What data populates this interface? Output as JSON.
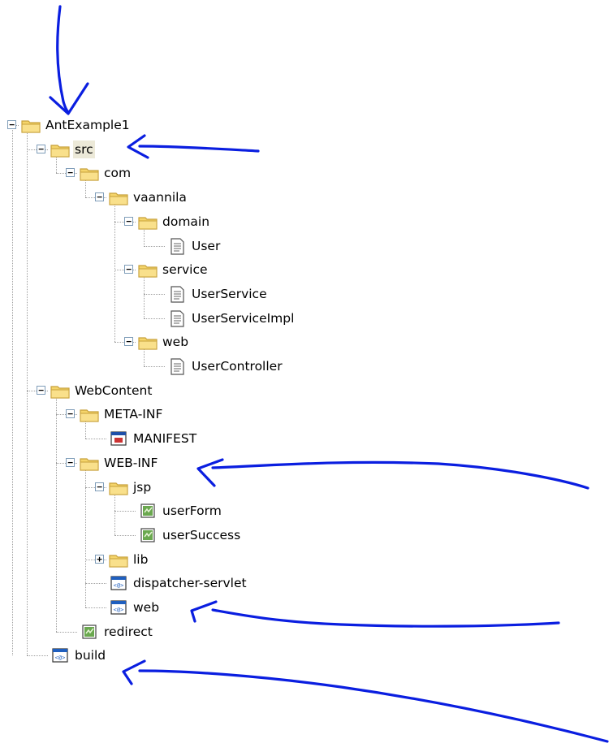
{
  "tree": [
    {
      "label": "AntExample1",
      "icon": "folder-icon",
      "level": 0,
      "expanded": true
    },
    {
      "label": "src",
      "icon": "folder-icon",
      "level": 1,
      "expanded": true,
      "selected": true
    },
    {
      "label": "com",
      "icon": "folder-icon",
      "level": 2,
      "expanded": true
    },
    {
      "label": "vaannila",
      "icon": "folder-icon",
      "level": 3,
      "expanded": true
    },
    {
      "label": "domain",
      "icon": "folder-icon",
      "level": 4,
      "expanded": true
    },
    {
      "label": "User",
      "icon": "java-file-icon",
      "level": 5
    },
    {
      "label": "service",
      "icon": "folder-icon",
      "level": 4,
      "expanded": true
    },
    {
      "label": "UserService",
      "icon": "java-file-icon",
      "level": 5
    },
    {
      "label": "UserServiceImpl",
      "icon": "java-file-icon",
      "level": 5
    },
    {
      "label": "web",
      "icon": "folder-icon",
      "level": 4,
      "expanded": true
    },
    {
      "label": "UserController",
      "icon": "java-file-icon",
      "level": 5
    },
    {
      "label": "WebContent",
      "icon": "folder-icon",
      "level": 1,
      "expanded": true
    },
    {
      "label": "META-INF",
      "icon": "folder-icon",
      "level": 2,
      "expanded": true
    },
    {
      "label": "MANIFEST",
      "icon": "manifest-file-icon",
      "level": 3
    },
    {
      "label": "WEB-INF",
      "icon": "folder-icon",
      "level": 2,
      "expanded": true
    },
    {
      "label": "jsp",
      "icon": "folder-icon",
      "level": 3,
      "expanded": true
    },
    {
      "label": "userForm",
      "icon": "jsp-file-icon",
      "level": 4
    },
    {
      "label": "userSuccess",
      "icon": "jsp-file-icon",
      "level": 4
    },
    {
      "label": "lib",
      "icon": "folder-icon",
      "level": 3,
      "expanded": false
    },
    {
      "label": "dispatcher-servlet",
      "icon": "xml-file-icon",
      "level": 3
    },
    {
      "label": "web",
      "icon": "xml-file-icon",
      "level": 3
    },
    {
      "label": "redirect",
      "icon": "jsp-file-icon",
      "level": 2
    },
    {
      "label": "build",
      "icon": "xml-file-icon",
      "level": 1
    }
  ],
  "colors": {
    "annotation": "#0a1ee0",
    "folder": "#f5d56b",
    "folder_border": "#c8a13a",
    "selection": "#ece9d8"
  },
  "annotations": [
    "arrow-to-antexample1",
    "arrow-to-src",
    "arrow-to-web-inf",
    "arrow-to-web",
    "arrow-to-build"
  ]
}
